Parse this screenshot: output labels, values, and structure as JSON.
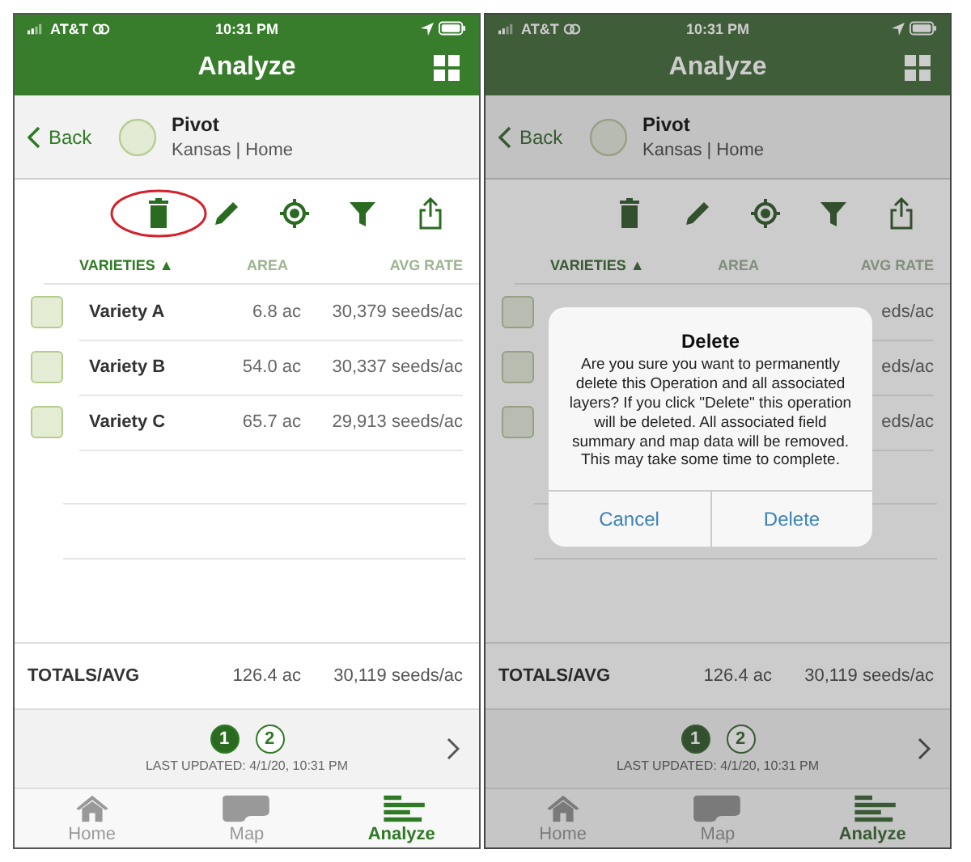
{
  "screens": [
    {
      "dimmed": false,
      "status_bar": {
        "carrier": "AT&T",
        "time": "10:31 PM"
      },
      "title": "Analyze",
      "header": {
        "back": "Back",
        "name": "Pivot",
        "subtitle": "Kansas | Home"
      },
      "toolbar": {
        "delete_circled": true
      },
      "columns": [
        "VARIETIES ▲",
        "AREA",
        "AVG RATE"
      ],
      "rows": [
        {
          "name": "Variety A",
          "area": "6.8 ac",
          "rate": "30,379 seeds/ac"
        },
        {
          "name": "Variety B",
          "area": "54.0 ac",
          "rate": "30,337 seeds/ac"
        },
        {
          "name": "Variety C",
          "area": "65.7 ac",
          "rate": "29,913 seeds/ac"
        }
      ],
      "totals": {
        "label": "TOTALS/AVG",
        "area": "126.4 ac",
        "rate": "30,119 seeds/ac"
      },
      "pager": {
        "pages": [
          {
            "label": "1",
            "selected": true
          },
          {
            "label": "2",
            "selected": false
          }
        ],
        "updated": "LAST UPDATED: 4/1/20, 10:31 PM"
      },
      "tabs": [
        {
          "label": "Home",
          "selected": false
        },
        {
          "label": "Map",
          "selected": false
        },
        {
          "label": "Analyze",
          "selected": true
        }
      ]
    },
    {
      "dimmed": true,
      "status_bar": {
        "carrier": "AT&T",
        "time": "10:31 PM"
      },
      "title": "Analyze",
      "header": {
        "back": "Back",
        "name": "Pivot",
        "subtitle": "Kansas | Home"
      },
      "toolbar": {
        "delete_circled": false
      },
      "columns": [
        "VARIETIES ▲",
        "AREA",
        "AVG RATE"
      ],
      "rows": [
        {
          "rate": "eds/ac"
        },
        {
          "rate": "eds/ac"
        },
        {
          "rate": "eds/ac"
        }
      ],
      "totals": {
        "label": "TOTALS/AVG",
        "area": "126.4 ac",
        "rate": "30,119 seeds/ac"
      },
      "pager": {
        "pages": [
          {
            "label": "1",
            "selected": true
          },
          {
            "label": "2",
            "selected": false
          }
        ],
        "updated": "LAST UPDATED: 4/1/20, 10:31 PM"
      },
      "tabs": [
        {
          "label": "Home",
          "selected": false
        },
        {
          "label": "Map",
          "selected": false
        },
        {
          "label": "Analyze",
          "selected": true
        }
      ],
      "dialog": {
        "title": "Delete",
        "message": "Are you sure you want to permanently delete this Operation and all associated layers?  If you click \"Delete\" this operation will be deleted. All associated field summary and map data will be removed.  This may take some time to complete.",
        "buttons": [
          "Cancel",
          "Delete"
        ]
      }
    }
  ]
}
